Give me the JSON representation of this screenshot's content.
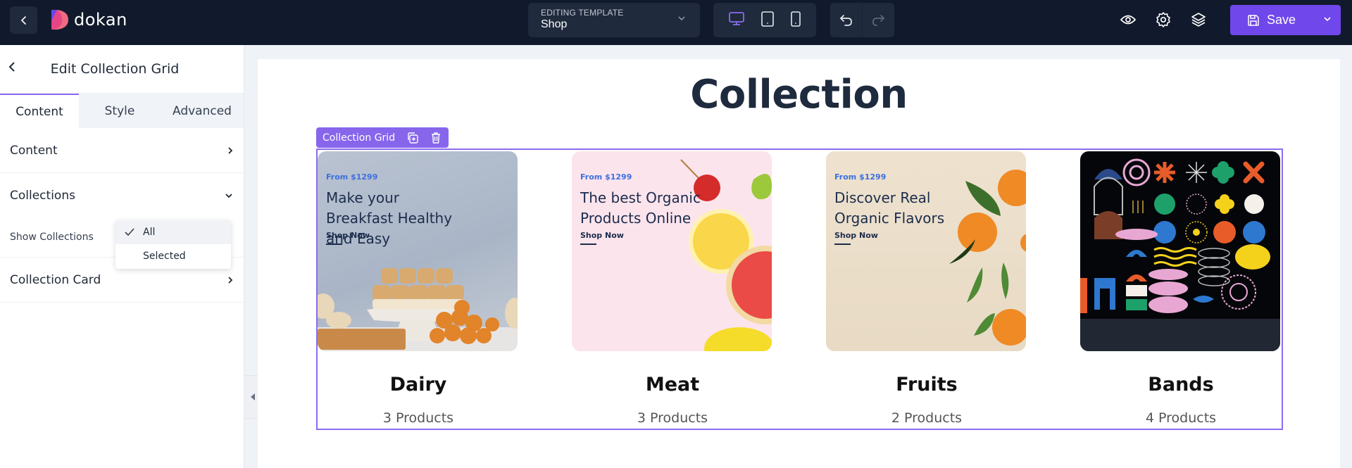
{
  "topbar": {
    "logo_text": "dokan",
    "template_label": "EDITING TEMPLATE",
    "template_value": "Shop",
    "devices": [
      "desktop",
      "tablet",
      "mobile"
    ],
    "active_device": "desktop",
    "save_label": "Save",
    "accent": "#7047eb"
  },
  "sidebar": {
    "title": "Edit Collection Grid",
    "tabs": [
      {
        "label": "Content",
        "active": true
      },
      {
        "label": "Style",
        "active": false
      },
      {
        "label": "Advanced",
        "active": false
      }
    ],
    "sections": {
      "content": {
        "label": "Content"
      },
      "collections": {
        "label": "Collections",
        "show_label": "Show Collections",
        "options": [
          "All",
          "Selected"
        ],
        "selected": "All"
      },
      "card": {
        "label": "Collection Card"
      }
    }
  },
  "canvas": {
    "title": "Collection",
    "widget_label": "Collection Grid",
    "cards": [
      {
        "name": "Dairy",
        "count": "3 Products",
        "from": "From $1299",
        "headline": "Make your Breakfast Healthy and Easy",
        "shop": "Shop Now"
      },
      {
        "name": "Meat",
        "count": "3 Products",
        "from": "From $1299",
        "headline": "The best Organic Products Online",
        "shop": "Shop Now"
      },
      {
        "name": "Fruits",
        "count": "2 Products",
        "from": "From $1299",
        "headline": "Discover Real Organic Flavors",
        "shop": "Shop Now"
      },
      {
        "name": "Bands",
        "count": "4 Products"
      }
    ]
  }
}
